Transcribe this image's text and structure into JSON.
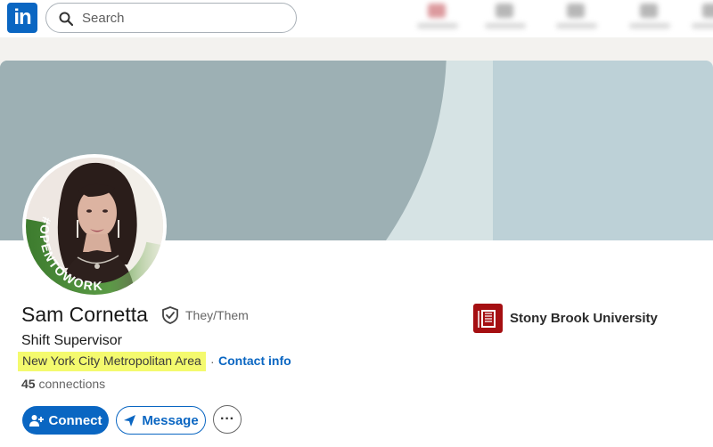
{
  "nav": {
    "logo": "in",
    "search_placeholder": "Search"
  },
  "profile": {
    "name": "Sam Cornetta",
    "pronouns": "They/Them",
    "headline": "Shift Supervisor",
    "location": "New York City Metropolitan Area",
    "separator": "·",
    "contact_label": "Contact info",
    "connections_count": "45",
    "connections_label": "connections",
    "open_to_work_badge": "#OPENTOWORK",
    "school": "Stony Brook University"
  },
  "actions": {
    "connect": "Connect",
    "message": "Message",
    "more": "···"
  },
  "colors": {
    "brand": "#0a66c2",
    "banner": "#bdd1d7",
    "open_to_work": "#4a8b3a",
    "highlight": "#f4fa6e",
    "school": "#a50f12"
  },
  "icons": [
    "search-icon",
    "verified-shield-icon",
    "add-person-icon",
    "send-icon",
    "more-icon",
    "school-logo"
  ]
}
